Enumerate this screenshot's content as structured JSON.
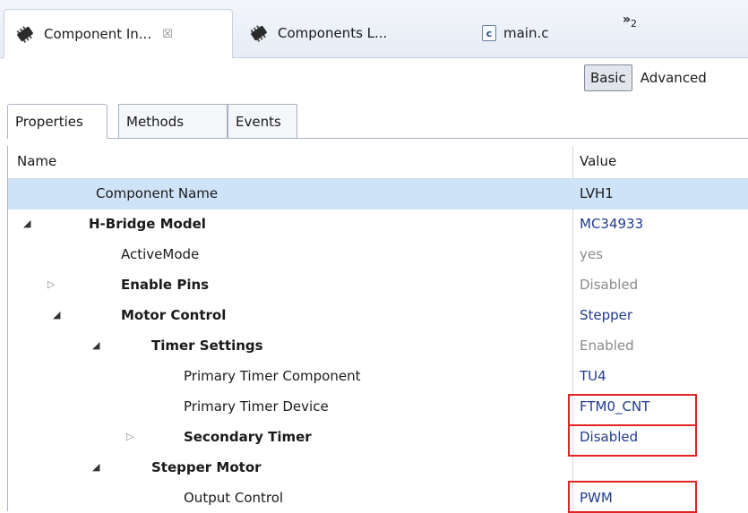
{
  "tabs": [
    {
      "label": "Component In...",
      "icon": "chip-icon",
      "active": true,
      "close_glyph": "☒"
    },
    {
      "label": "Components L...",
      "icon": "chip-icon",
      "active": false
    },
    {
      "label": "main.c",
      "icon": "c-file-icon",
      "icon_text": "c",
      "active": false
    }
  ],
  "overflow": {
    "label": "»",
    "count": "2"
  },
  "mode": {
    "basic": "Basic",
    "advanced": "Advanced",
    "selected": "Basic"
  },
  "inner_tabs": [
    "Properties",
    "Methods",
    "Events"
  ],
  "table": {
    "headers": {
      "name": "Name",
      "value": "Value"
    },
    "rows": [
      {
        "name": "Component Name",
        "value": "LVH1",
        "bold": false,
        "expander": "",
        "value_style": "dark"
      },
      {
        "name": "H-Bridge Model",
        "value": "MC34933",
        "bold": true,
        "expander": "expanded",
        "value_style": "link"
      },
      {
        "name": "ActiveMode",
        "value": "yes",
        "bold": false,
        "expander": "",
        "value_style": "gray"
      },
      {
        "name": "Enable Pins",
        "value": "Disabled",
        "bold": true,
        "expander": "collapsed",
        "value_style": "gray"
      },
      {
        "name": "Motor Control",
        "value": "Stepper",
        "bold": true,
        "expander": "expanded",
        "value_style": "blue"
      },
      {
        "name": "Timer Settings",
        "value": "Enabled",
        "bold": true,
        "expander": "expanded",
        "value_style": "gray"
      },
      {
        "name": "Primary Timer Component",
        "value": "TU4",
        "bold": false,
        "expander": "",
        "value_style": "blue"
      },
      {
        "name": "Primary Timer Device",
        "value": "FTM0_CNT",
        "bold": false,
        "expander": "",
        "value_style": "blue"
      },
      {
        "name": "Secondary Timer",
        "value": "Disabled",
        "bold": true,
        "expander": "collapsed",
        "value_style": "blue"
      },
      {
        "name": "Stepper Motor",
        "value": "",
        "bold": true,
        "expander": "expanded",
        "value_style": "dark"
      },
      {
        "name": "Output Control",
        "value": "PWM",
        "bold": false,
        "expander": "",
        "value_style": "blue"
      }
    ]
  },
  "colors": {
    "highlight": "#e02424",
    "selection": "#cfe3f8",
    "link": "#1f3b8c"
  }
}
